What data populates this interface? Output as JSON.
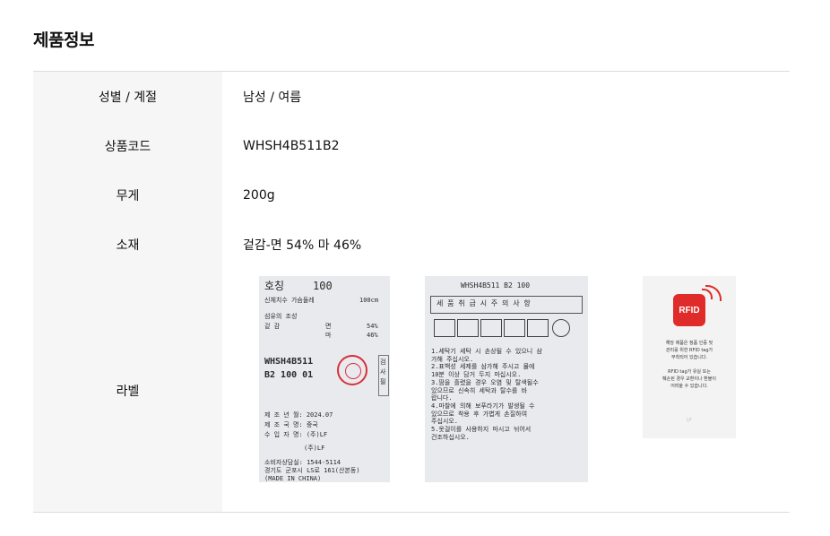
{
  "section": {
    "title": "제품정보"
  },
  "rows": [
    {
      "label": "성별 / 계절",
      "value": "남성 / 여름"
    },
    {
      "label": "상품코드",
      "value": "WHSH4B511B2"
    },
    {
      "label": "무게",
      "value": "200g"
    },
    {
      "label": "소재",
      "value": "겉감-면 54% 마 46%"
    },
    {
      "label": "라벨"
    }
  ],
  "label_images": {
    "size_tag": {
      "size_word": "호칭",
      "size": "100",
      "measure_label": "신체치수 가슴둘레",
      "measure_value": "100cm",
      "fiber_title": "섬유의 조성",
      "shell_label": "겉 감",
      "fiber1": "면",
      "fiber1_pct": "54%",
      "fiber2": "마",
      "fiber2_pct": "46%",
      "code_line1": "WHSH4B511",
      "code_line2": "B2 100 01",
      "inspected": "검사필",
      "made_date": "제 조 년 월: 2024.07",
      "made_country": "제 조 국 명: 중국",
      "importer": "수 입 자 명: (주)LF",
      "company": "(주)LF",
      "consumer_tel": "소비자상담실: 1544-5114",
      "address": "경기도 군포시 LS로 161(산본동)",
      "made_in": "(MADE IN CHINA)"
    },
    "care_tag": {
      "code": "WHSH4B511 B2 100",
      "heading": "세 품 취 급 시  주 의  사 항",
      "notes": [
        "1.세탁기 세탁 시 손상될 수 있으니 삼",
        "  가해 주십시오.",
        "2.표백성 세제를 삼가해 주시고 물에",
        "  10분 이상 담거 두지 마십시오.",
        "3.땀을 흘렸을 경우 오염 및 탈색될수",
        "  있으므로 신속히 세탁과 탈수를 바",
        "  랍니다.",
        "4.마찰에 의해 보푸라기가 발생될 수",
        "  있으므로 착용 후 가볍게 손질하여",
        "  주십시오.",
        "5.옷걸이를 사용하지 마시고 뉘어서",
        "  건조하십시오."
      ]
    },
    "rfid_tag": {
      "logo": "RFID",
      "text1": "해당 제품은 정품 인증 및",
      "text2": "관리를 위한 RFID tag가",
      "text3": "부착되어 있습니다.",
      "text4": "RFID tag가 유실 또는",
      "text5": "훼손된 경우 교환이나 환불이",
      "text6": "어려울 수 있습니다.",
      "brand": "LF"
    }
  }
}
